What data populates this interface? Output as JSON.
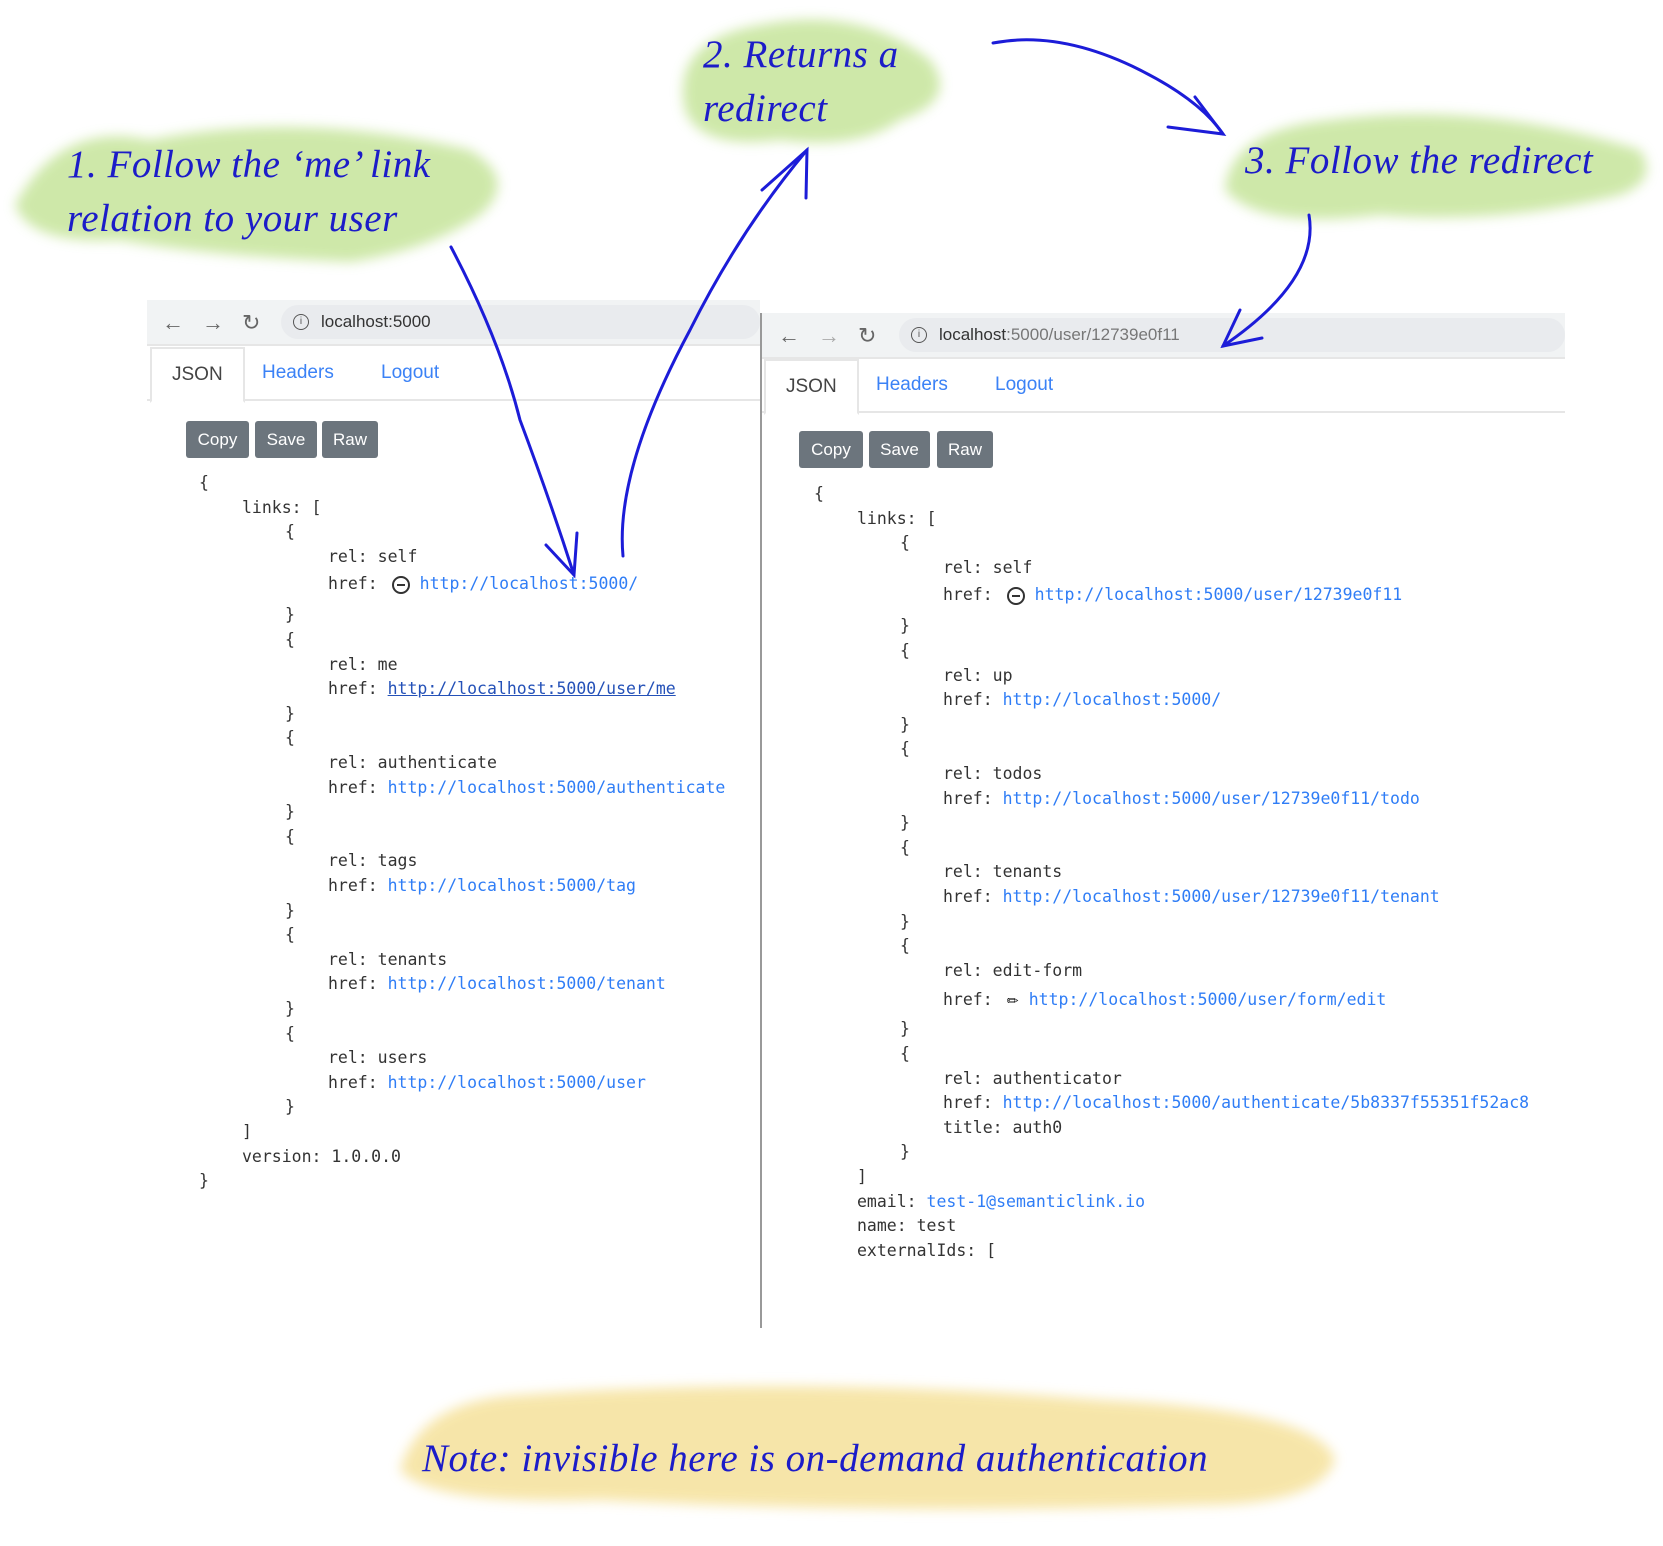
{
  "annotations": {
    "step1": [
      "1. Follow the ‘me’ link",
      "relation to your user"
    ],
    "step2": [
      "2. Returns a",
      "redirect"
    ],
    "step3": "3. Follow the redirect",
    "note": "Note: invisible here is on-demand authentication",
    "colors": {
      "ink": "#1c1cc8",
      "green": "#c9e6a0",
      "yellow": "#f6e3a0"
    }
  },
  "left": {
    "url": "localhost:5000",
    "url_dim": "",
    "tabs": [
      "JSON",
      "Headers",
      "Logout"
    ],
    "buttons": [
      "Copy",
      "Save",
      "Raw"
    ],
    "lines": [
      {
        "i": 0,
        "p": [
          {
            "t": "{"
          }
        ]
      },
      {
        "i": 1,
        "p": [
          {
            "t": "links: ["
          }
        ]
      },
      {
        "i": 2,
        "p": [
          {
            "t": "{"
          }
        ]
      },
      {
        "i": 3,
        "p": [
          {
            "t": "rel: self"
          }
        ]
      },
      {
        "i": 3,
        "icon": "minus-circle",
        "p": [
          {
            "t": "href:"
          },
          {
            "t": "http://localhost:5000/",
            "c": "lnk"
          }
        ]
      },
      {
        "i": 2,
        "p": [
          {
            "t": "}"
          }
        ]
      },
      {
        "i": 2,
        "p": [
          {
            "t": "{"
          }
        ]
      },
      {
        "i": 3,
        "p": [
          {
            "t": "rel: me"
          }
        ]
      },
      {
        "i": 3,
        "p": [
          {
            "t": "href: "
          },
          {
            "t": "http://localhost:5000/user/me",
            "c": "ul"
          }
        ]
      },
      {
        "i": 2,
        "p": [
          {
            "t": "}"
          }
        ]
      },
      {
        "i": 2,
        "p": [
          {
            "t": "{"
          }
        ]
      },
      {
        "i": 3,
        "p": [
          {
            "t": "rel: authenticate"
          }
        ]
      },
      {
        "i": 3,
        "p": [
          {
            "t": "href: "
          },
          {
            "t": "http://localhost:5000/authenticate",
            "c": "lnk"
          }
        ]
      },
      {
        "i": 2,
        "p": [
          {
            "t": "}"
          }
        ]
      },
      {
        "i": 2,
        "p": [
          {
            "t": "{"
          }
        ]
      },
      {
        "i": 3,
        "p": [
          {
            "t": "rel: tags"
          }
        ]
      },
      {
        "i": 3,
        "p": [
          {
            "t": "href: "
          },
          {
            "t": "http://localhost:5000/tag",
            "c": "lnk"
          }
        ]
      },
      {
        "i": 2,
        "p": [
          {
            "t": "}"
          }
        ]
      },
      {
        "i": 2,
        "p": [
          {
            "t": "{"
          }
        ]
      },
      {
        "i": 3,
        "p": [
          {
            "t": "rel: tenants"
          }
        ]
      },
      {
        "i": 3,
        "p": [
          {
            "t": "href: "
          },
          {
            "t": "http://localhost:5000/tenant",
            "c": "lnk"
          }
        ]
      },
      {
        "i": 2,
        "p": [
          {
            "t": "}"
          }
        ]
      },
      {
        "i": 2,
        "p": [
          {
            "t": "{"
          }
        ]
      },
      {
        "i": 3,
        "p": [
          {
            "t": "rel: users"
          }
        ]
      },
      {
        "i": 3,
        "p": [
          {
            "t": "href: "
          },
          {
            "t": "http://localhost:5000/user",
            "c": "lnk"
          }
        ]
      },
      {
        "i": 2,
        "p": [
          {
            "t": "}"
          }
        ]
      },
      {
        "i": 1,
        "p": [
          {
            "t": "]"
          }
        ]
      },
      {
        "i": 1,
        "p": [
          {
            "t": "version: 1.0.0.0"
          }
        ]
      },
      {
        "i": 0,
        "p": [
          {
            "t": "}"
          }
        ]
      }
    ]
  },
  "right": {
    "url": "localhost",
    "url_dim": ":5000/user/12739e0f11",
    "tabs": [
      "JSON",
      "Headers",
      "Logout"
    ],
    "buttons": [
      "Copy",
      "Save",
      "Raw"
    ],
    "lines": [
      {
        "i": 0,
        "p": [
          {
            "t": "{"
          }
        ]
      },
      {
        "i": 1,
        "p": [
          {
            "t": "links: ["
          }
        ]
      },
      {
        "i": 2,
        "p": [
          {
            "t": "{"
          }
        ]
      },
      {
        "i": 3,
        "p": [
          {
            "t": "rel: self"
          }
        ]
      },
      {
        "i": 3,
        "icon": "minus-circle",
        "p": [
          {
            "t": "href:"
          },
          {
            "t": "http://localhost:5000/user/12739e0f11",
            "c": "lnk"
          }
        ]
      },
      {
        "i": 2,
        "p": [
          {
            "t": "}"
          }
        ]
      },
      {
        "i": 2,
        "p": [
          {
            "t": "{"
          }
        ]
      },
      {
        "i": 3,
        "p": [
          {
            "t": "rel: up"
          }
        ]
      },
      {
        "i": 3,
        "p": [
          {
            "t": "href: "
          },
          {
            "t": "http://localhost:5000/",
            "c": "lnk"
          }
        ]
      },
      {
        "i": 2,
        "p": [
          {
            "t": "}"
          }
        ]
      },
      {
        "i": 2,
        "p": [
          {
            "t": "{"
          }
        ]
      },
      {
        "i": 3,
        "p": [
          {
            "t": "rel: todos"
          }
        ]
      },
      {
        "i": 3,
        "p": [
          {
            "t": "href: "
          },
          {
            "t": "http://localhost:5000/user/12739e0f11/todo",
            "c": "lnk"
          }
        ]
      },
      {
        "i": 2,
        "p": [
          {
            "t": "}"
          }
        ]
      },
      {
        "i": 2,
        "p": [
          {
            "t": "{"
          }
        ]
      },
      {
        "i": 3,
        "p": [
          {
            "t": "rel: tenants"
          }
        ]
      },
      {
        "i": 3,
        "p": [
          {
            "t": "href: "
          },
          {
            "t": "http://localhost:5000/user/12739e0f11/tenant",
            "c": "lnk"
          }
        ]
      },
      {
        "i": 2,
        "p": [
          {
            "t": "}"
          }
        ]
      },
      {
        "i": 2,
        "p": [
          {
            "t": "{"
          }
        ]
      },
      {
        "i": 3,
        "p": [
          {
            "t": "rel: edit-form"
          }
        ]
      },
      {
        "i": 3,
        "icon": "pencil",
        "p": [
          {
            "t": "href:"
          },
          {
            "t": "http://localhost:5000/user/form/edit",
            "c": "lnk"
          }
        ]
      },
      {
        "i": 2,
        "p": [
          {
            "t": "}"
          }
        ]
      },
      {
        "i": 2,
        "p": [
          {
            "t": "{"
          }
        ]
      },
      {
        "i": 3,
        "p": [
          {
            "t": "rel: authenticator"
          }
        ]
      },
      {
        "i": 3,
        "p": [
          {
            "t": "href: "
          },
          {
            "t": "http://localhost:5000/authenticate/5b8337f55351f52ac8",
            "c": "lnk"
          }
        ]
      },
      {
        "i": 3,
        "p": [
          {
            "t": "title: auth0"
          }
        ]
      },
      {
        "i": 2,
        "p": [
          {
            "t": "}"
          }
        ]
      },
      {
        "i": 1,
        "p": [
          {
            "t": "]"
          }
        ]
      },
      {
        "i": 1,
        "p": [
          {
            "t": "email: "
          },
          {
            "t": "test-1@semanticlink.io",
            "c": "lnk"
          }
        ]
      },
      {
        "i": 1,
        "p": [
          {
            "t": "name: test"
          }
        ]
      },
      {
        "i": 1,
        "p": [
          {
            "t": "externalIds: ["
          }
        ]
      }
    ]
  }
}
